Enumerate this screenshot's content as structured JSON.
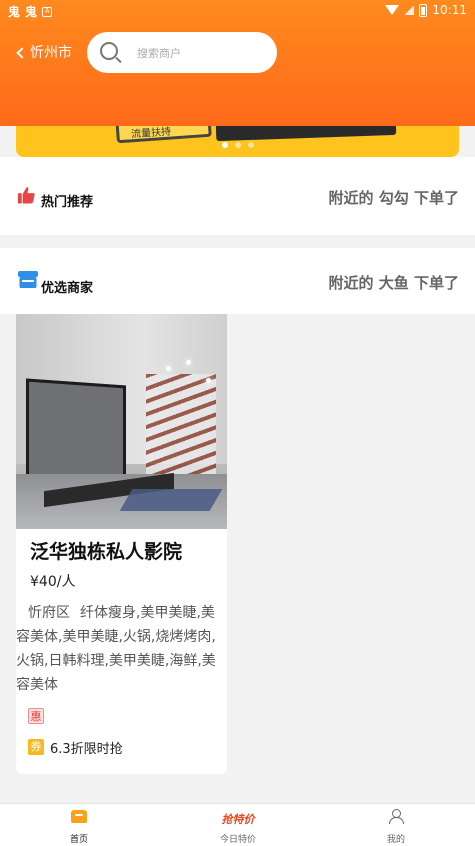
{
  "status_bar": {
    "left_glyphs": [
      "鬼",
      "鬼"
    ],
    "box_label": "A",
    "time": "10:11"
  },
  "header": {
    "city": "忻州市",
    "search_placeholder": "搜索商户"
  },
  "banner": {
    "tag_text": "流量扶持",
    "page_count": 3,
    "active_page": 1
  },
  "colors": {
    "header_orange": "#ff7a1e",
    "banner_yellow": "#ffc31e",
    "badge_red": "#e04040",
    "coupon_yellow": "#f8b81f"
  },
  "hot_section": {
    "icon": "thumbs-up-icon",
    "title": "热门推荐",
    "note": "附近的 勾勾 下单了"
  },
  "pick_section": {
    "icon": "store-icon",
    "title": "优选商家",
    "note": "附近的 大鱼 下单了"
  },
  "merchant_card": {
    "name": "泛华独栋私人影院",
    "price": "¥40/人",
    "district": "忻府区",
    "categories": "纤体瘦身,美甲美睫,美容美体,美甲美睫,火锅,烧烤烤肉,火锅,日韩料理,美甲美睫,海鲜,美容美体",
    "badge_hui": "惠",
    "badge_quan": "券",
    "discount": "6.3折限时抢"
  },
  "bottom_nav": {
    "home": "首页",
    "deal_logo": "抢特价",
    "deal": "今日特价",
    "mine": "我的"
  }
}
